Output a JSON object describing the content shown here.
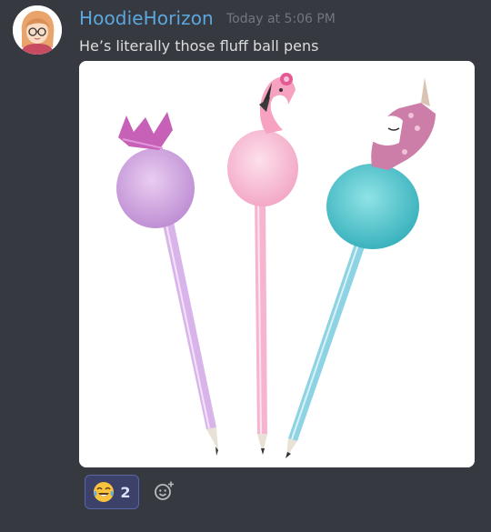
{
  "message": {
    "username": "HoodieHorizon",
    "timestamp": "Today at 5:06 PM",
    "content": "He’s literally those fluff ball pens"
  },
  "attachment": {
    "icon": "image-attachment"
  },
  "reactions": [
    {
      "emoji": "joy-emoji-icon",
      "count": "2"
    }
  ],
  "add_reaction": {
    "icon": "add-reaction-icon"
  },
  "colors": {
    "background": "#36393f",
    "username": "#5ba8e0",
    "reaction_bg": "#3b4168"
  }
}
